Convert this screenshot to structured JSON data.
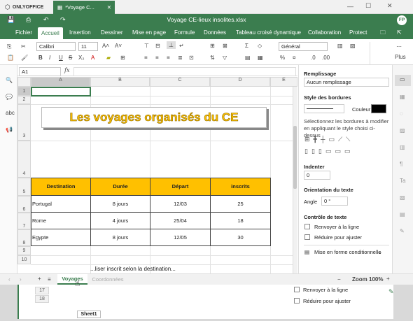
{
  "app": {
    "name": "ONLYOFFICE",
    "tab_title": "*Voyage C...",
    "window_title": "Voyage CE-lieux insolites.xlsx",
    "user_initials": "FP"
  },
  "ribbon": {
    "tabs": [
      "Fichier",
      "Accueil",
      "Insertion",
      "Dessiner",
      "Mise en page",
      "Formule",
      "Données",
      "Tableau croisé dynamique",
      "Collaboration",
      "Protect"
    ],
    "active": "Accueil"
  },
  "toolbar": {
    "font": "Calibri",
    "size": "11",
    "number_format": "Général",
    "plus_label": "Plus"
  },
  "formula_bar": {
    "cell_ref": "A1",
    "fx": "fx",
    "content": ""
  },
  "grid": {
    "columns": [
      "A",
      "B",
      "C",
      "D",
      "E"
    ],
    "rows": [
      "1",
      "2",
      "3",
      "4",
      "5",
      "6",
      "7",
      "8",
      "9",
      "10"
    ],
    "title": "Les voyages organisés du CE",
    "headers": [
      "Destination",
      "Durée",
      "Départ",
      "inscrits"
    ],
    "data": [
      [
        "Portugal",
        "8 jours",
        "12/03",
        "25"
      ],
      [
        "Rome",
        "4 jours",
        "25/04",
        "18"
      ],
      [
        "Egypte",
        "8 jours",
        "12/05",
        "30"
      ]
    ],
    "partial_text": "...liser inscrit selon la destination..."
  },
  "sheets": {
    "tabs": [
      "Voyages",
      "Coordonnées"
    ],
    "active": "Voyages",
    "zoom": "Zoom 100%"
  },
  "panel": {
    "fill_title": "Remplissage",
    "fill_value": "Aucun remplissage",
    "borders_title": "Style des bordures",
    "color_label": "Couleur",
    "border_hint": "Sélectionnez les bordures à modifier en appliquant le style choisi ci-dessus",
    "indent_title": "Indenter",
    "indent_value": "0",
    "orient_title": "Orientation du texte",
    "angle_label": "Angle",
    "angle_value": "0 °",
    "control_title": "Contrôle de texte",
    "wrap": "Renvoyer à la ligne",
    "shrink": "Réduire pour ajuster",
    "cond_format": "Mise en forme conditionnelle"
  },
  "background": {
    "rows": [
      "17",
      "18"
    ],
    "sheet": "Sheet1",
    "wrap": "Renvoyer à la ligne",
    "shrink": "Réduire pour ajuster"
  }
}
